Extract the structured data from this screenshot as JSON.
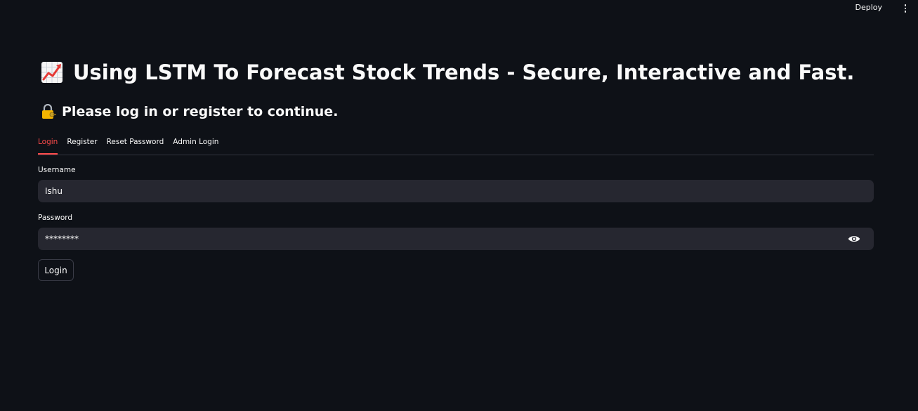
{
  "header": {
    "deploy_label": "Deploy",
    "menu_icon": "vertical-dots-icon"
  },
  "main": {
    "title": "Using LSTM To Forecast Stock Trends - Secure, Interactive and Fast.",
    "title_icon": "chart-increasing-icon",
    "subtitle": "Please log in or register to continue.",
    "subtitle_icon": "lock-with-key-icon"
  },
  "tabs": [
    {
      "label": "Login",
      "active": true
    },
    {
      "label": "Register",
      "active": false
    },
    {
      "label": "Reset Password",
      "active": false
    },
    {
      "label": "Admin Login",
      "active": false
    }
  ],
  "form": {
    "username_label": "Username",
    "username_value": "Ishu",
    "password_label": "Password",
    "password_value": "********",
    "password_toggle_icon": "eye-icon",
    "submit_label": "Login"
  },
  "colors": {
    "background": "#0e1117",
    "input_background": "#262730",
    "accent": "#ff4b4b",
    "text": "#fafafa"
  }
}
